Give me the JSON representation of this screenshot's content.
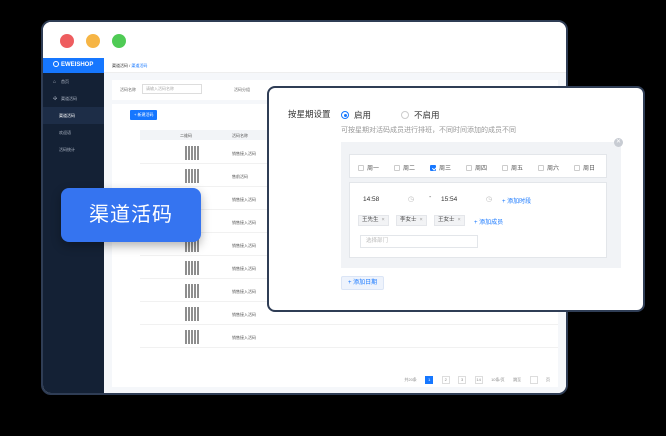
{
  "bg_window": {
    "logo": "EWEISHOP",
    "sidebar": {
      "items": [
        {
          "label": "首页"
        },
        {
          "label": "渠道活码"
        },
        {
          "label": "渠道活码"
        },
        {
          "label": "欢迎语"
        },
        {
          "label": "活码统计"
        }
      ]
    },
    "breadcrumb": {
      "parent": "渠道活码",
      "current": "渠道活码"
    },
    "filter": {
      "name_label": "活码名称",
      "name_placeholder": "请输入活码名称",
      "group_label": "活码分组"
    },
    "new_button": "+ 新建活码",
    "columns": [
      "二维码",
      "活码名称"
    ],
    "rows": [
      {
        "name": "销售接入活码"
      },
      {
        "name": "售前活码"
      },
      {
        "name": "销售接入活码"
      },
      {
        "name": "销售接入活码"
      },
      {
        "name": "销售接入活码"
      },
      {
        "name": "销售接入活码"
      },
      {
        "name": "销售接入活码"
      },
      {
        "name": "销售接入活码"
      },
      {
        "name": "销售接入活码"
      }
    ],
    "pager": {
      "total": "共20条",
      "pages": [
        "1",
        "2",
        "3",
        "14"
      ],
      "size": "10条/页",
      "goto": "跳至",
      "goto_suffix": "页"
    }
  },
  "badge": {
    "text": "渠道活码"
  },
  "settings": {
    "row_label": "按星期设置",
    "enable": "启用",
    "disable": "不启用",
    "hint": "可按星期对活码成员进行排班，不同时间添加的成员不同",
    "weekdays": [
      {
        "label": "周一",
        "checked": false
      },
      {
        "label": "周二",
        "checked": false
      },
      {
        "label": "周三",
        "checked": true
      },
      {
        "label": "周四",
        "checked": false
      },
      {
        "label": "周五",
        "checked": false
      },
      {
        "label": "周六",
        "checked": false
      },
      {
        "label": "周日",
        "checked": false
      }
    ],
    "start_time": "14:58",
    "end_time": "15:54",
    "time_separator": "-",
    "add_time": "+ 添加时段",
    "members": [
      "王先生",
      "李女士",
      "王女士"
    ],
    "add_member": "+ 添加成员",
    "dept_placeholder": "选择部门",
    "add_date": "+ 添加日期"
  },
  "colors": {
    "accent": "#1677ff",
    "badge": "#3574f0",
    "sidebar": "#142135"
  }
}
